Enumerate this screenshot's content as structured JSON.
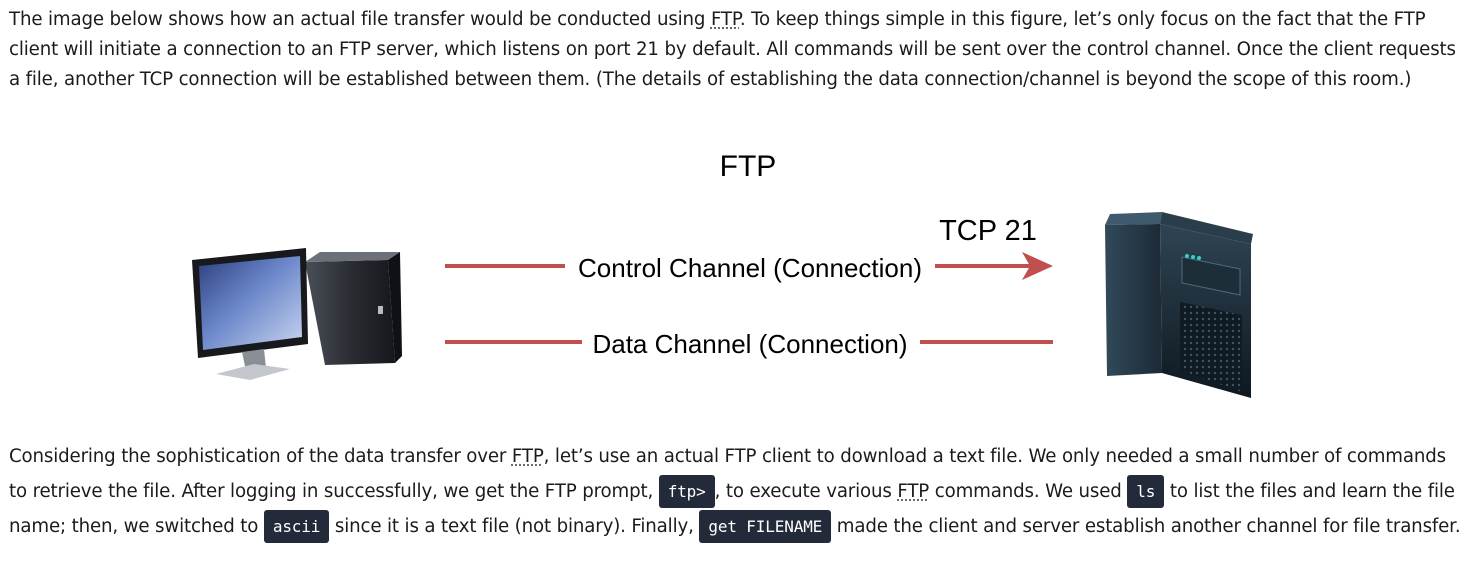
{
  "paragraph1": {
    "t1": "The image below shows how an actual file transfer would be conducted using ",
    "ftp": "FTP",
    "t2": ". To keep things simple in this figure, let’s only focus on the fact that the FTP client will initiate a connection to an FTP server, which listens on port 21 by default. All commands will be sent over the control channel. Once the client requests a file, another TCP connection will be established between them. (The details of establishing the data connection/channel is beyond the scope of this room.)"
  },
  "figure": {
    "title": "FTP",
    "port_label": "TCP 21",
    "control_label": "Control Channel (Connection)",
    "data_label": "Data Channel (Connection)",
    "client_icon": "desktop-computer-icon",
    "server_icon": "server-tower-icon",
    "line_color": "#c0504d"
  },
  "paragraph2": {
    "t1": "Considering the sophistication of the data transfer over ",
    "ftp1": "FTP",
    "t2": ", let’s use an actual FTP client to download a text file. We only needed a small number of commands to retrieve the file. After logging in successfully, we get the FTP prompt, ",
    "code_prompt": "ftp>",
    "t3": ", to execute various ",
    "ftp2": "FTP",
    "t4": " commands. We used ",
    "code_ls": "ls",
    "t5": " to list the files and learn the file name; then, we switched to ",
    "code_ascii": "ascii",
    "t6": " since it is a text file (not binary). Finally, ",
    "code_get": "get FILENAME",
    "t7": " made the client and server establish another channel for file transfer."
  }
}
